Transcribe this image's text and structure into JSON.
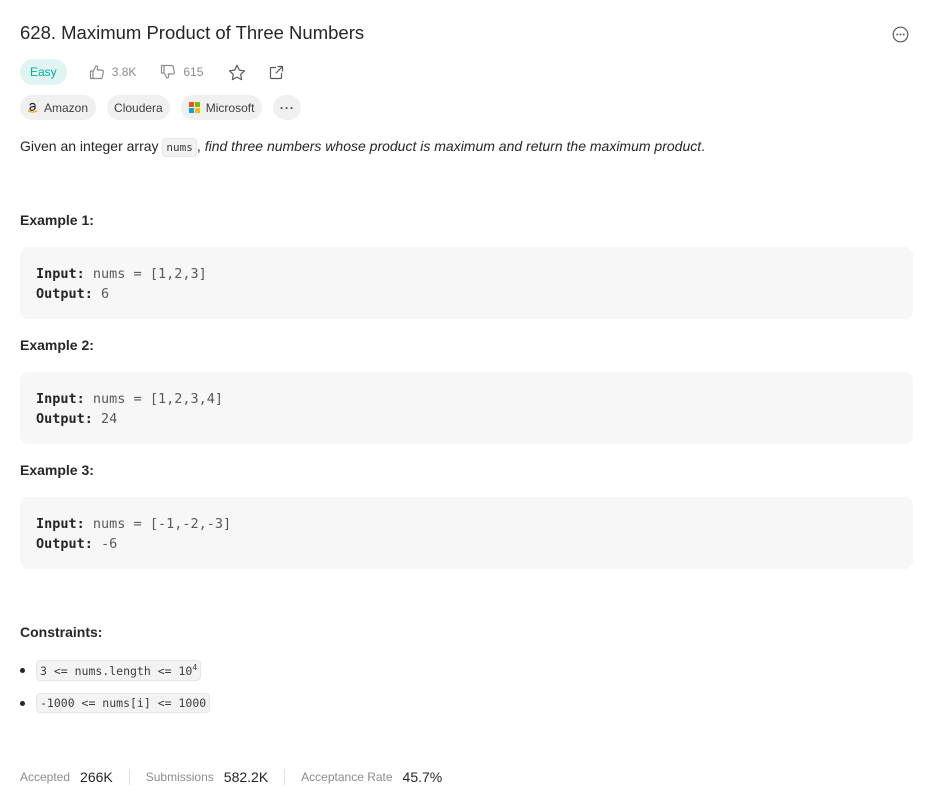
{
  "problem": {
    "title": "628. Maximum Product of Three Numbers",
    "difficulty": "Easy",
    "likes": "3.8K",
    "dislikes": "615"
  },
  "tags": {
    "amazon": "Amazon",
    "cloudera": "Cloudera",
    "microsoft": "Microsoft",
    "more": "···"
  },
  "description": {
    "prefix": "Given an integer array ",
    "code": "nums",
    "sep": ", ",
    "emphasis": "find three numbers whose product is maximum and return the maximum product",
    "suffix": "."
  },
  "examples": [
    {
      "title": "Example 1:",
      "input_label": "Input:",
      "input": "nums = [1,2,3]",
      "output_label": "Output:",
      "output": "6"
    },
    {
      "title": "Example 2:",
      "input_label": "Input:",
      "input": "nums = [1,2,3,4]",
      "output_label": "Output:",
      "output": "24"
    },
    {
      "title": "Example 3:",
      "input_label": "Input:",
      "input": "nums = [-1,-2,-3]",
      "output_label": "Output:",
      "output": "-6"
    }
  ],
  "constraints": {
    "title": "Constraints:",
    "items": [
      {
        "text": "3 <= nums.length <= 10",
        "sup": "4"
      },
      {
        "text": "-1000 <= nums[i] <= 1000",
        "sup": ""
      }
    ]
  },
  "stats": {
    "accepted_label": "Accepted",
    "accepted_value": "266K",
    "submissions_label": "Submissions",
    "submissions_value": "582.2K",
    "rate_label": "Acceptance Rate",
    "rate_value": "45.7%"
  },
  "colors": {
    "easy": "#00af9b",
    "easy_bg": "#e0f4f1",
    "code_bg": "#f7f7f8"
  },
  "icons": [
    "more-icon",
    "thumbs-up-icon",
    "thumbs-down-icon",
    "star-icon",
    "share-icon",
    "amazon-logo",
    "microsoft-logo"
  ]
}
